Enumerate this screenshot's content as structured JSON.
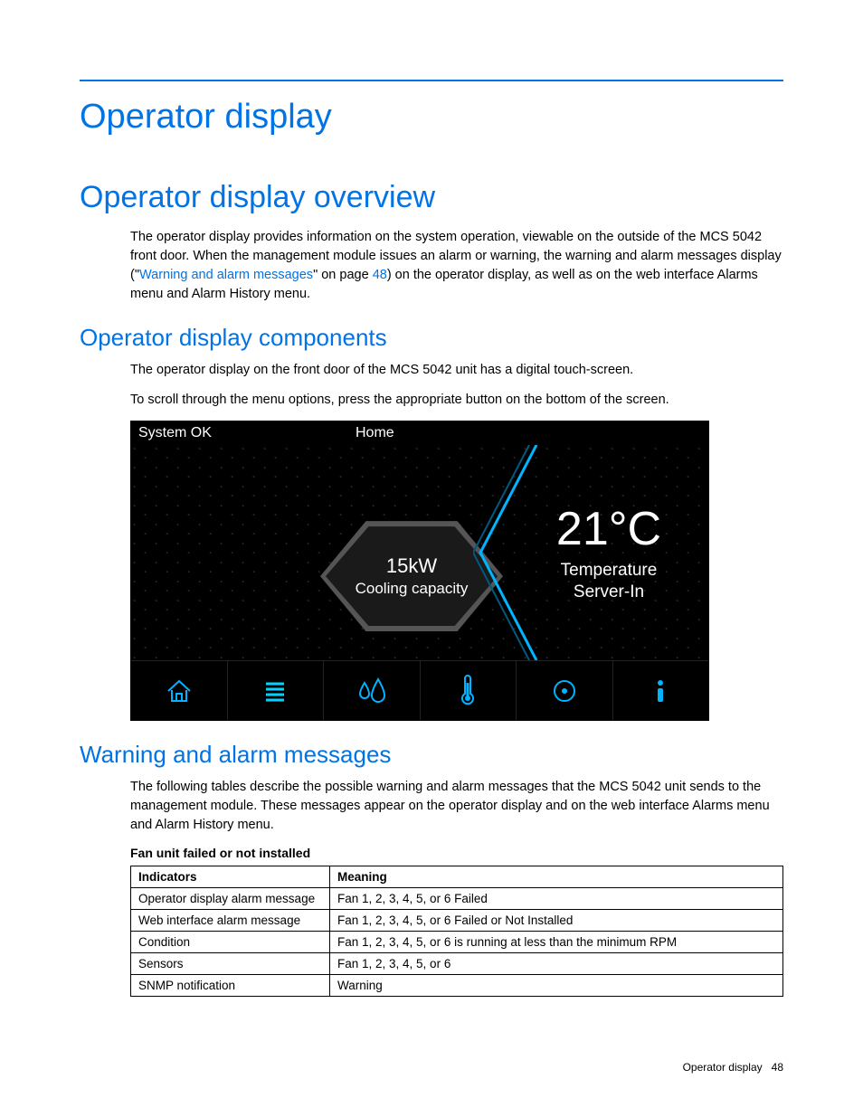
{
  "chapter": {
    "title": "Operator display"
  },
  "section1": {
    "title": "Operator display overview",
    "para_a": "The operator display provides information on the system operation, viewable on the outside of the MCS 5042 front door. When the management module issues an alarm or warning, the warning and alarm messages display (\"",
    "link_text": "Warning and alarm messages",
    "para_b": "\" on page ",
    "page_ref": "48",
    "para_c": ") on the operator display, as well as on the web interface Alarms menu and Alarm History menu."
  },
  "subsection_components": {
    "title": "Operator display components",
    "p1": "The operator display on the front door of the MCS 5042 unit has a digital touch-screen.",
    "p2": "To scroll through the menu options, press the appropriate button on the bottom of the screen."
  },
  "touchscreen": {
    "status": "System OK",
    "screen_name": "Home",
    "hex_value": "15kW",
    "hex_label": "Cooling capacity",
    "temp_value": "21°C",
    "temp_label_1": "Temperature",
    "temp_label_2": "Server-In",
    "nav": {
      "home": "home-icon",
      "menu": "menu-icon",
      "humidity": "humidity-icon",
      "temperature": "thermometer-icon",
      "target": "target-icon",
      "info": "info-icon"
    }
  },
  "subsection_warning": {
    "title": "Warning and alarm messages",
    "p1": "The following tables describe the possible warning and alarm messages that the MCS 5042 unit sends to the management module. These messages appear on the operator display and on the web interface Alarms menu and Alarm History menu."
  },
  "table1": {
    "caption": "Fan unit failed or not installed",
    "headers": {
      "c1": "Indicators",
      "c2": "Meaning"
    },
    "rows": [
      {
        "c1": "Operator display alarm message",
        "c2": "Fan 1, 2, 3, 4, 5, or 6 Failed"
      },
      {
        "c1": "Web interface alarm message",
        "c2": "Fan 1, 2, 3, 4, 5, or 6 Failed or Not Installed"
      },
      {
        "c1": "Condition",
        "c2": "Fan 1, 2, 3, 4, 5, or 6 is running at less than the minimum RPM"
      },
      {
        "c1": "Sensors",
        "c2": "Fan 1, 2, 3, 4, 5, or 6"
      },
      {
        "c1": "SNMP notification",
        "c2": "Warning"
      }
    ]
  },
  "footer": {
    "section": "Operator display",
    "page": "48"
  }
}
